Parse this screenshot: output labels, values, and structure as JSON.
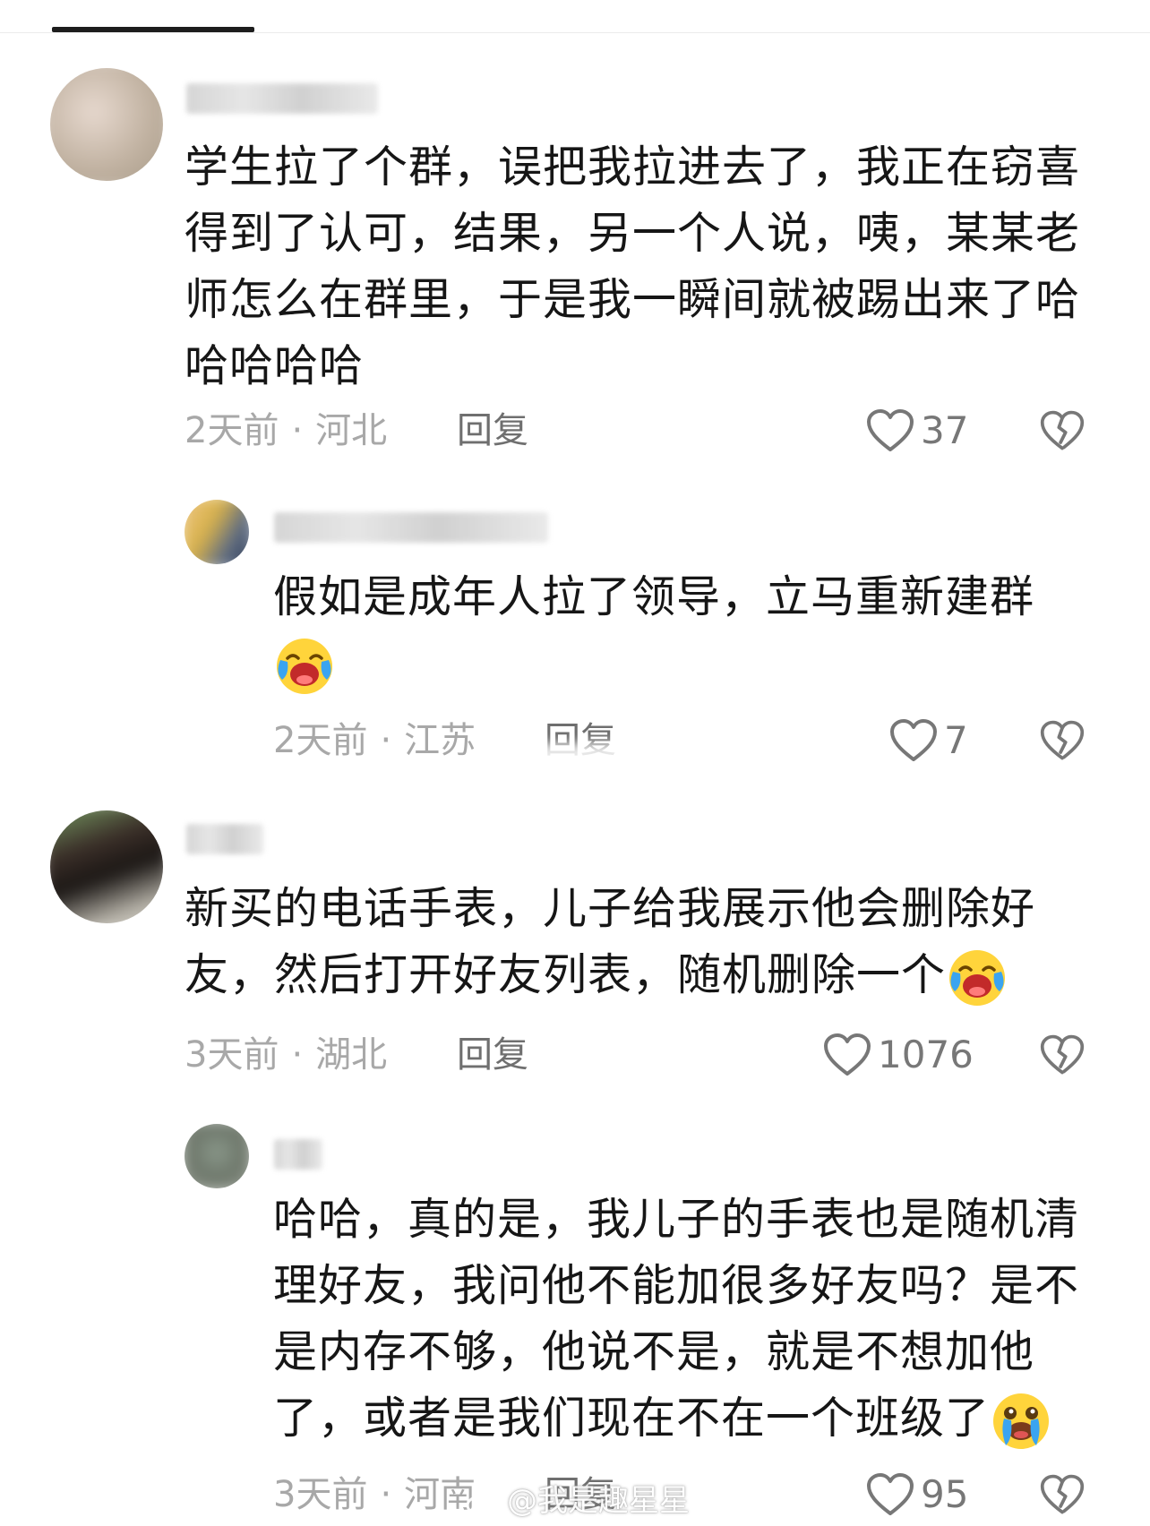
{
  "comments": [
    {
      "text": "学生拉了个群，误把我拉进去了，我正在窃喜得到了认可，结果，另一个人说，咦，某某老师怎么在群里，于是我一瞬间就被踢出来了哈哈哈哈哈",
      "time": "2天前",
      "location": "河北",
      "reply_label": "回复",
      "likes": "37"
    },
    {
      "text": "假如是成年人拉了领导，立马重新建群",
      "time": "2天前",
      "location": "江苏",
      "reply_label": "回复",
      "likes": "7"
    },
    {
      "text": "新买的电话手表，儿子给我展示他会删除好友，然后打开好友列表，随机删除一个",
      "time": "3天前",
      "location": "湖北",
      "reply_label": "回复",
      "likes": "1076"
    },
    {
      "text": "哈哈，真的是，我儿子的手表也是随机清理好友，我问他不能加很多好友吗？是不是内存不够，他说不是，就是不想加他了，或者是我们现在不在一个班级了",
      "time": "3天前",
      "location": "河南",
      "reply_label": "回复",
      "likes": "95"
    }
  ],
  "separator": "·",
  "watermark": "@我是趣星星",
  "icons": {
    "like": "heart-outline-icon",
    "dislike": "broken-heart-icon",
    "emoji_laugh": "laughing-crying-emoji",
    "emoji_cry": "loudly-crying-emoji"
  },
  "colors": {
    "text": "#161616",
    "meta": "#a8a8a8",
    "icon": "#777777"
  }
}
